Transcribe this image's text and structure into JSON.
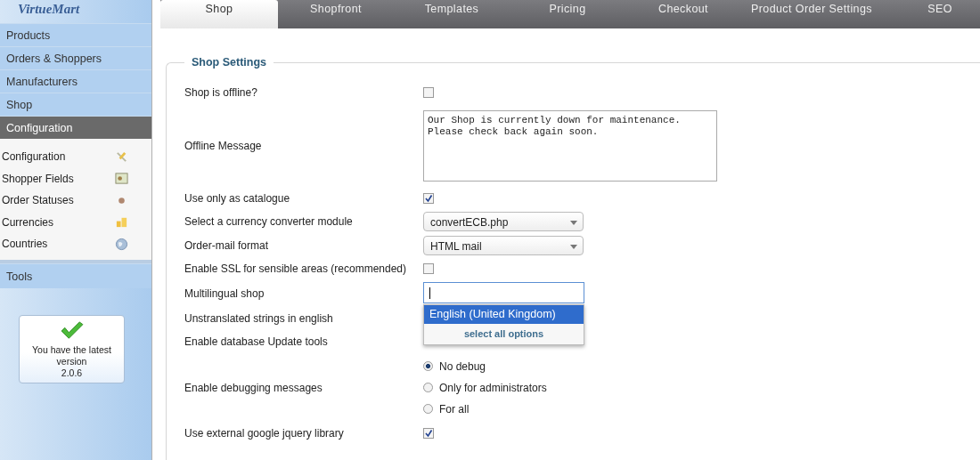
{
  "sidebar": {
    "logo": "VirtueMart",
    "menu": [
      {
        "label": "Products",
        "selected": false
      },
      {
        "label": "Orders & Shoppers",
        "selected": false
      },
      {
        "label": "Manufacturers",
        "selected": false
      },
      {
        "label": "Shop",
        "selected": false
      },
      {
        "label": "Configuration",
        "selected": true
      }
    ],
    "submenu": [
      {
        "label": "Configuration",
        "kind": "tools"
      },
      {
        "label": "Shopper Fields",
        "kind": "form"
      },
      {
        "label": "Order Statuses",
        "kind": "dot"
      },
      {
        "label": "Currencies",
        "kind": "coins"
      },
      {
        "label": "Countries",
        "kind": "globe"
      }
    ],
    "tools": {
      "label": "Tools",
      "selected": false
    },
    "version_box": {
      "message": "You have the latest version",
      "version": "2.0.6"
    }
  },
  "tabs": [
    {
      "label": "Shop",
      "selected": true
    },
    {
      "label": "Shopfront",
      "selected": false
    },
    {
      "label": "Templates",
      "selected": false
    },
    {
      "label": "Pricing",
      "selected": false
    },
    {
      "label": "Checkout",
      "selected": false
    },
    {
      "label": "Product Order Settings",
      "selected": false
    },
    {
      "label": "SEO",
      "selected": false
    }
  ],
  "fieldset": {
    "legend": "Shop Settings",
    "rows": [
      {
        "kind": "checkbox",
        "label": "Shop is offline?",
        "checked": false
      },
      {
        "kind": "textarea",
        "label": "Offline Message",
        "value": "Our Shop is currently down for maintenance. Please check back again soon."
      },
      {
        "kind": "checkbox",
        "label": "Use only as catalogue",
        "checked": true
      },
      {
        "kind": "select",
        "label": "Select a currency converter module",
        "value": "convertECB.php"
      },
      {
        "kind": "select",
        "label": "Order-mail format",
        "value": "HTML mail"
      },
      {
        "kind": "checkbox",
        "label": "Enable SSL for sensible areas (recommended)",
        "checked": false
      },
      {
        "kind": "multiselect",
        "label": "Multilingual shop",
        "options": [
          {
            "label": "English (United Kingdom)",
            "selected": true
          }
        ],
        "select_all": "select all options"
      },
      {
        "kind": "plain",
        "label": "Unstranslated strings in english"
      },
      {
        "kind": "plain",
        "label": "Enable database Update tools"
      },
      {
        "kind": "radio",
        "label": "Enable debugging messages",
        "options": [
          {
            "label": "No debug",
            "selected": true
          },
          {
            "label": "Only for administrators",
            "selected": false
          },
          {
            "label": "For all",
            "selected": false
          }
        ]
      },
      {
        "kind": "checkbox",
        "label": "Use external google jquery library",
        "checked": true
      }
    ]
  }
}
